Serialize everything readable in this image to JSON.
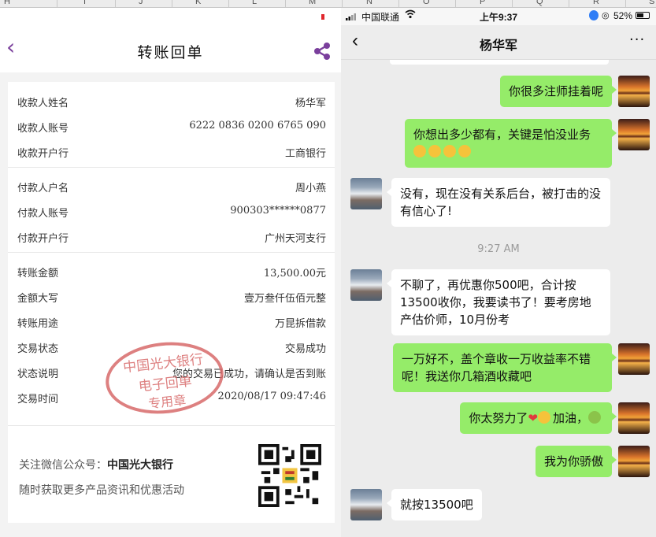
{
  "spreadsheet": {
    "columns": [
      "H",
      "I",
      "J",
      "K",
      "L",
      "M",
      "N",
      "O",
      "P",
      "Q",
      "R",
      "S"
    ]
  },
  "receipt": {
    "title": "转账回单",
    "payee_section": [
      {
        "label": "收款人姓名",
        "value": "杨华军"
      },
      {
        "label": "收款人账号",
        "value": "6222 0836 0200 6765 090"
      },
      {
        "label": "收款开户行",
        "value": "工商银行"
      }
    ],
    "payer_section": [
      {
        "label": "付款人户名",
        "value": "周小燕"
      },
      {
        "label": "付款人账号",
        "value": "900303******0877"
      },
      {
        "label": "付款开户行",
        "value": "广州天河支行"
      }
    ],
    "transfer_section": [
      {
        "label": "转账金额",
        "value": "13,500.00元"
      },
      {
        "label": "金额大写",
        "value": "壹万叁仟伍佰元整"
      },
      {
        "label": "转账用途",
        "value": "万昆拆借款"
      },
      {
        "label": "交易状态",
        "value": "交易成功"
      },
      {
        "label": "状态说明",
        "value": "您的交易已成功，请确认是否到账"
      },
      {
        "label": "交易时间",
        "value": "2020/08/17 09:47:46"
      }
    ],
    "stamp": {
      "line1": "中国光大银行",
      "line2": "电子回单",
      "line3": "专用章"
    },
    "footer": {
      "follow_prefix": "关注微信公众号：",
      "follow_name": "中国光大银行",
      "promo": "随时获取更多产品资讯和优惠活动"
    },
    "icons": {
      "back": "chevron-left-icon",
      "share": "share-icon",
      "qr": "qr-code-icon"
    },
    "colors": {
      "accent": "#7a3f9c",
      "stamp": "#d86a6a"
    }
  },
  "chat": {
    "status_bar": {
      "carrier": "中国联通",
      "time": "上午9:37",
      "battery": "52%"
    },
    "contact_name": "杨华军",
    "timestamp": "9:27 AM",
    "messages": [
      {
        "from": "me",
        "text": "你很多注师挂着呢"
      },
      {
        "from": "me",
        "text": "你想出多少都有，关键是怕没业务"
      },
      {
        "from": "them",
        "text": "没有，现在没有关系后台，被打击的没有信心了!"
      },
      {
        "from": "them",
        "text": "不聊了，再优惠你500吧，合计按13500收你，我要读书了！要考房地产估价师，10月份考"
      },
      {
        "from": "me",
        "text": "一万好不，盖个章收一万收益率不错呢！我送你几箱酒收藏吧"
      },
      {
        "from": "me",
        "text_before": "你太努力了",
        "text_mid": "加油，",
        "text": "你太努力了❤加油，"
      },
      {
        "from": "me",
        "text": "我为你骄傲"
      },
      {
        "from": "them",
        "text": "就按13500吧"
      }
    ],
    "colors": {
      "me_bubble": "#95ec69",
      "them_bubble": "#ffffff",
      "background": "#ececec"
    }
  }
}
